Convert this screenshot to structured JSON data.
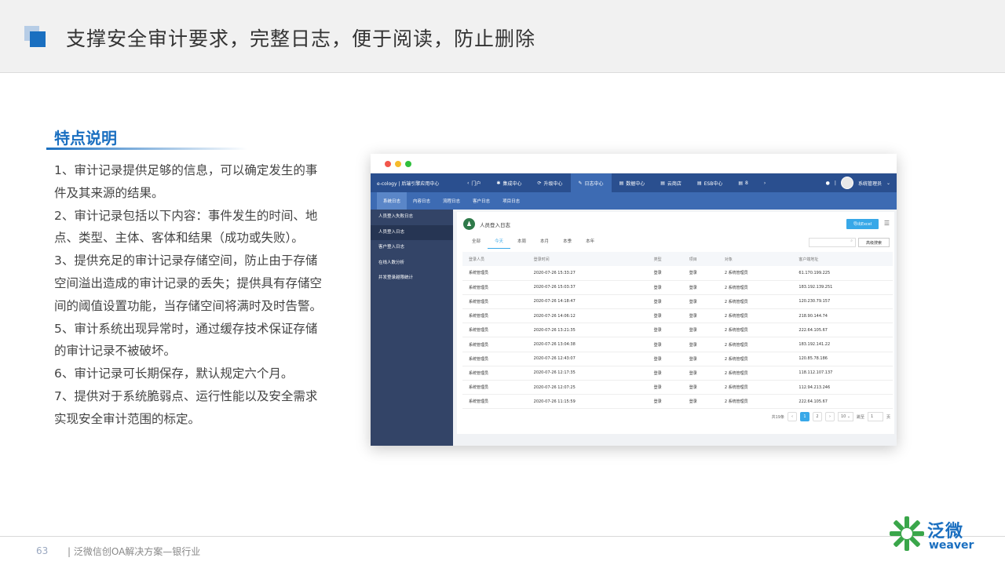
{
  "header": {
    "title": "支撑安全审计要求，完整日志，便于阅读，防止删除"
  },
  "section": {
    "title": "特点说明",
    "paragraphs": [
      "1、审计记录提供足够的信息，可以确定发生的事件及其来源的结果。",
      "2、审计记录包括以下内容：事件发生的时间、地点、类型、主体、客体和结果（成功或失败）。",
      "3、提供充足的审计记录存储空间，防止由于存储空间溢出造成的审计记录的丢失；提供具有存储空间的阈值设置功能，当存储空间将满时及时告警。",
      "5、审计系统出现异常时，通过缓存技术保证存储的审计记录不被破坏。",
      "6、审计记录可长期保存，默认规定六个月。",
      "7、提供对于系统脆弱点、运行性能以及安全需求实现安全审计范围的标定。"
    ]
  },
  "app": {
    "brand": "e-cology | 后端引擎应用中心",
    "nav": [
      "门户",
      "集成中心",
      "升级中心",
      "日志中心",
      "数据中心",
      "云商店",
      "ESB中心",
      "8"
    ],
    "active_nav": "日志中心",
    "user": "系统管理员",
    "subnav": [
      "系统日志",
      "内容日志",
      "流程日志",
      "客户日志",
      "项目日志"
    ],
    "sidebar": [
      "人员登入失败日志",
      "人员登入日志",
      "客户登入日志",
      "在线人数分析",
      "并发登录越限统计"
    ],
    "card_title": "人员登入日志",
    "export_label": "导出Excel",
    "tabs": [
      "全部",
      "今天",
      "本周",
      "本月",
      "本季",
      "本年"
    ],
    "advanced_search": "高级搜索",
    "columns": [
      "登录人员",
      "登录时间",
      "类型",
      "项目",
      "对象",
      "客户端地址"
    ],
    "rows": [
      [
        "系统管理员",
        "2020-07-26 15:33:27",
        "登录",
        "登录",
        "2 系统管理员",
        "61.170.199.225"
      ],
      [
        "系统管理员",
        "2020-07-26 15:03:37",
        "登录",
        "登录",
        "2 系统管理员",
        "183.192.139.251"
      ],
      [
        "系统管理员",
        "2020-07-26 14:18:47",
        "登录",
        "登录",
        "2 系统管理员",
        "120.230.79.157"
      ],
      [
        "系统管理员",
        "2020-07-26 14:06:12",
        "登录",
        "登录",
        "2 系统管理员",
        "218.90.144.74"
      ],
      [
        "系统管理员",
        "2020-07-26 13:21:35",
        "登录",
        "登录",
        "2 系统管理员",
        "222.64.105.67"
      ],
      [
        "系统管理员",
        "2020-07-26 13:04:38",
        "登录",
        "登录",
        "2 系统管理员",
        "183.192.141.22"
      ],
      [
        "系统管理员",
        "2020-07-26 12:43:07",
        "登录",
        "登录",
        "2 系统管理员",
        "120.85.78.186"
      ],
      [
        "系统管理员",
        "2020-07-26 12:17:35",
        "登录",
        "登录",
        "2 系统管理员",
        "118.112.107.137"
      ],
      [
        "系统管理员",
        "2020-07-26 12:07:25",
        "登录",
        "登录",
        "2 系统管理员",
        "112.94.213.246"
      ],
      [
        "系统管理员",
        "2020-07-26 11:15:59",
        "登录",
        "登录",
        "2 系统管理员",
        "222.64.105.67"
      ]
    ],
    "pager": {
      "total": "共19条",
      "pages": [
        "1",
        "2"
      ],
      "current": "1",
      "size": "10",
      "goto_label": "跳至",
      "goto_value": "1",
      "page_unit": "页"
    }
  },
  "footer": {
    "page_number": "63",
    "text": "|  泛微信创OA解决方案—银行业"
  },
  "logo": {
    "cn": "泛微",
    "en": "weaver"
  },
  "colors": {
    "accent": "#1a6fc0",
    "nav": "#2a4f8f",
    "sidebar": "#334467",
    "button": "#38a8e8"
  }
}
